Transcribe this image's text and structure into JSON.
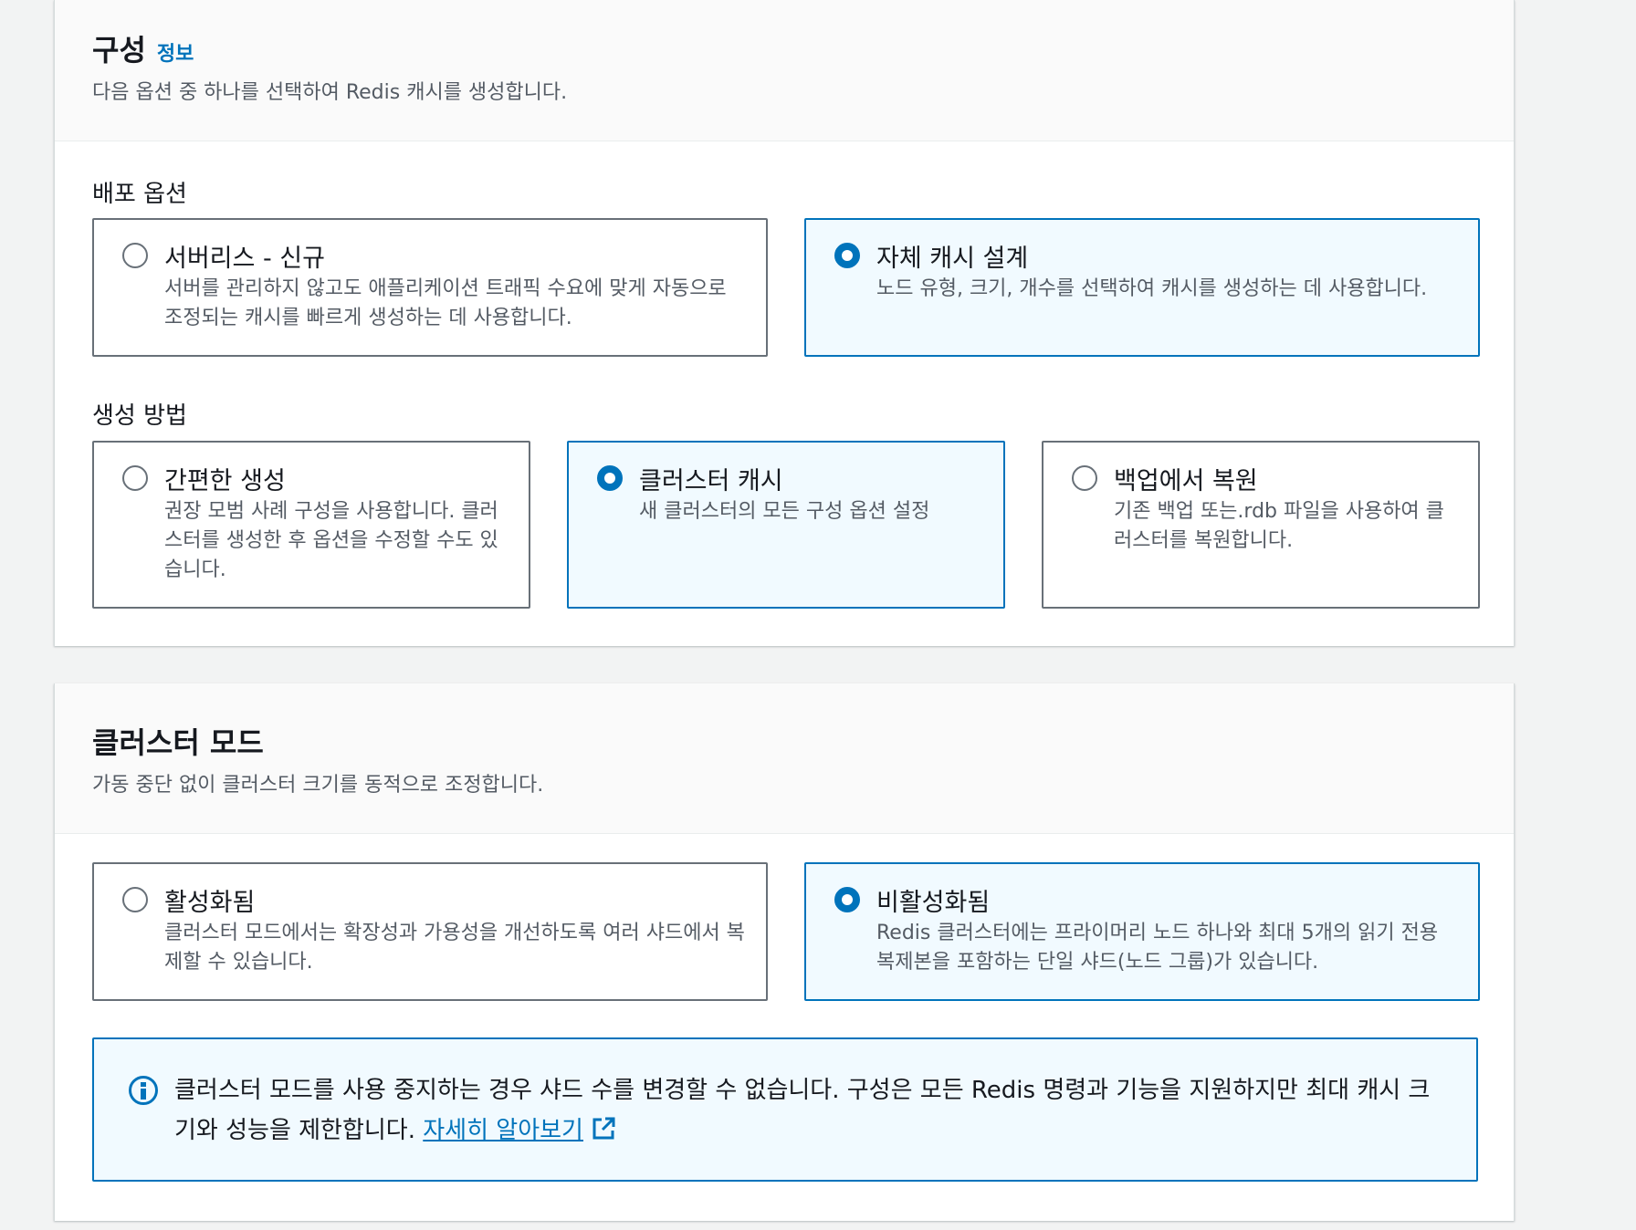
{
  "config": {
    "title": "구성",
    "info": "정보",
    "description": "다음 옵션 중 하나를 선택하여 Redis 캐시를 생성합니다.",
    "deployment": {
      "label": "배포 옵션",
      "options": [
        {
          "label": "서버리스 - 신규",
          "description": "서버를 관리하지 않고도 애플리케이션 트래픽 수요에 맞게 자동으로 조정되는 캐시를 빠르게 생성하는 데 사용합니다.",
          "selected": false
        },
        {
          "label": "자체 캐시 설계",
          "description": "노드 유형, 크기, 개수를 선택하여 캐시를 생성하는 데 사용합니다.",
          "selected": true
        }
      ]
    },
    "creation": {
      "label": "생성 방법",
      "options": [
        {
          "label": "간편한 생성",
          "description": "권장 모범 사례 구성을 사용합니다. 클러스터를 생성한 후 옵션을 수정할 수도 있습니다.",
          "selected": false
        },
        {
          "label": "클러스터 캐시",
          "description": "새 클러스터의 모든 구성 옵션 설정",
          "selected": true
        },
        {
          "label": "백업에서 복원",
          "description": "기존 백업 또는.rdb 파일을 사용하여 클러스터를 복원합니다.",
          "selected": false
        }
      ]
    }
  },
  "cluster_mode": {
    "title": "클러스터 모드",
    "description": "가동 중단 없이 클러스터 크기를 동적으로 조정합니다.",
    "options": [
      {
        "label": "활성화됨",
        "description": "클러스터 모드에서는 확장성과 가용성을 개선하도록 여러 샤드에서 복제할 수 있습니다.",
        "selected": false
      },
      {
        "label": "비활성화됨",
        "description": "Redis 클러스터에는 프라이머리 노드 하나와 최대 5개의 읽기 전용 복제본을 포함하는 단일 샤드(노드 그룹)가 있습니다.",
        "selected": true
      }
    ],
    "alert": {
      "icon": "info-icon",
      "text": "클러스터 모드를 사용 중지하는 경우 샤드 수를 변경할 수 없습니다. 구성은 모든 Redis 명령과 기능을 지원하지만 최대 캐시 크기와 성능을 제한합니다. ",
      "link": "자세히 알아보기",
      "link_icon": "external-link-icon"
    }
  },
  "colors": {
    "accent": "#0073bb",
    "selected_bg": "#f1faff",
    "page_bg": "#f2f3f3"
  }
}
